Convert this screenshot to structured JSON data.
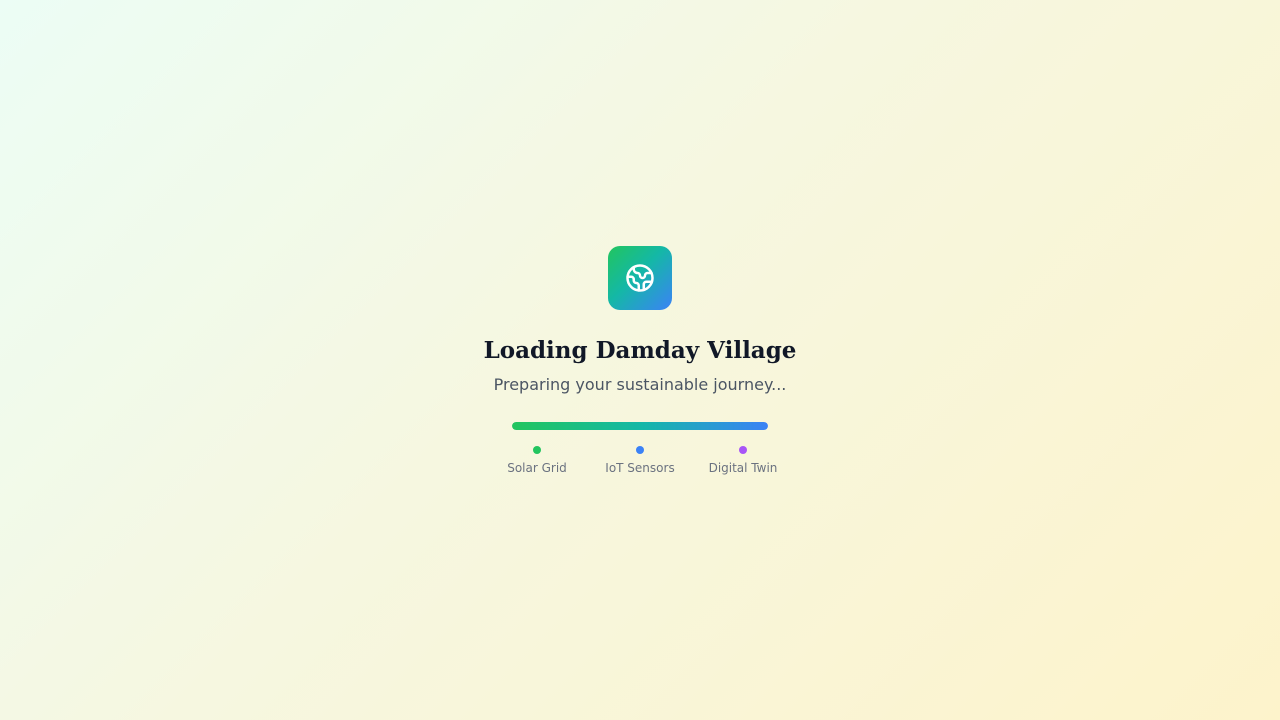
{
  "loader": {
    "logo_icon": "globe-icon",
    "title": "Loading Damday Village",
    "subtitle": "Preparing your sustainable journey...",
    "progress": 1.0,
    "steps": [
      {
        "label": "Solar Grid",
        "color": "#22c55e"
      },
      {
        "label": "IoT Sensors",
        "color": "#3b82f6"
      },
      {
        "label": "Digital Twin",
        "color": "#a855f7"
      }
    ]
  }
}
